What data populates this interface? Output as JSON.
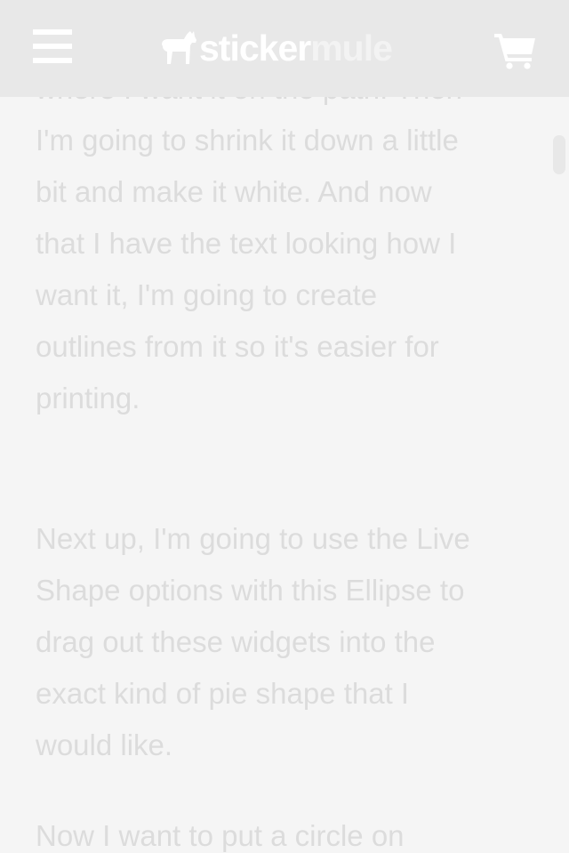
{
  "header": {
    "menu_icon": "hamburger-menu-icon",
    "logo": {
      "part_a": "sticker",
      "part_b": "mule",
      "icon": "mule-icon"
    },
    "cart_icon": "shopping-cart-icon"
  },
  "article": {
    "paragraphs": [
      {
        "lines": [
          "where I want it on the path. Then",
          "I'm going to shrink it down a little",
          "bit and make it white. And now",
          "that I have the text looking how I",
          "want it, I'm going to create",
          "outlines from it so it's easier for",
          "printing."
        ]
      },
      {
        "lines": [
          "Next up, I'm going to use the Live",
          "Shape options with this Ellipse to",
          "drag out these widgets into the",
          "exact kind of pie shape that I",
          "would like."
        ]
      },
      {
        "lines": [
          "Now I want to put a circle on"
        ]
      }
    ]
  },
  "colors": {
    "header_bg": "#e8e8e8",
    "page_bg": "#f5f5f5",
    "text": "#dcdcdc",
    "icon": "#ffffff"
  }
}
